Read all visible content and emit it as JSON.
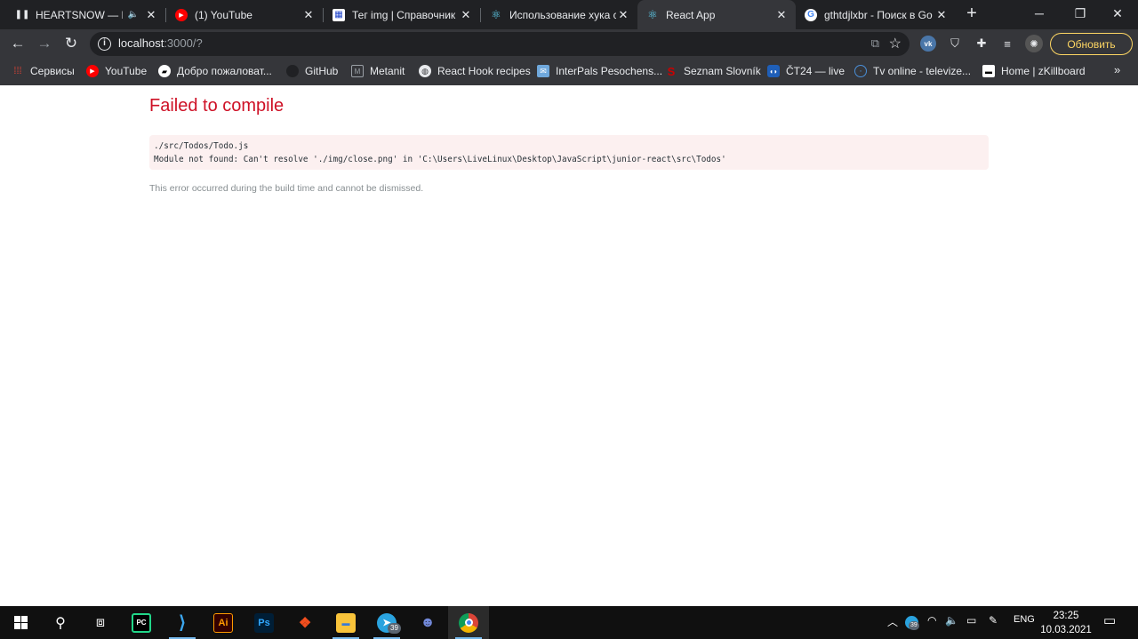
{
  "browser": {
    "tabs": [
      {
        "title": "HEARTSNOW — Pr",
        "icon": "pause-icon",
        "audio": true,
        "active": false
      },
      {
        "title": "(1) YouTube",
        "icon": "youtube-icon",
        "active": false
      },
      {
        "title": "Тег img | Справочник",
        "icon": "htmlbook-icon",
        "active": false
      },
      {
        "title": "Использование хука с",
        "icon": "react-icon",
        "active": false
      },
      {
        "title": "React App",
        "icon": "react-icon",
        "active": true
      },
      {
        "title": "gthtdjlxbr - Поиск в Go",
        "icon": "google-icon",
        "active": false
      }
    ],
    "url": {
      "host": "localhost",
      "path": ":3000/?"
    },
    "update_label": "Обновить",
    "bookmarks": [
      {
        "label": "Сервисы",
        "icon": "apps-grid-icon"
      },
      {
        "label": "YouTube",
        "icon": "youtube-icon"
      },
      {
        "label": "Добро пожаловат...",
        "icon": "chat-icon"
      },
      {
        "label": "GitHub",
        "icon": "github-icon"
      },
      {
        "label": "Metanit",
        "icon": "metanit-icon"
      },
      {
        "label": "React Hook recipes",
        "icon": "globe-icon"
      },
      {
        "label": "InterPals Pesochens...",
        "icon": "mail-icon"
      },
      {
        "label": "Seznam Slovník",
        "icon": "seznam-icon"
      },
      {
        "label": "ČT24 — live",
        "icon": "ct24-icon"
      },
      {
        "label": "Tv online - televize...",
        "icon": "tv-icon"
      },
      {
        "label": "Home | zKillboard",
        "icon": "zkillboard-icon"
      }
    ]
  },
  "page": {
    "title": "Failed to compile",
    "error_line1": "./src/Todos/Todo.js",
    "error_line2": "Module not found: Can't resolve './img/close.png' in 'C:\\Users\\LiveLinux\\Desktop\\JavaScript\\junior-react\\src\\Todos'",
    "note": "This error occurred during the build time and cannot be dismissed."
  },
  "taskbar": {
    "apps": [
      "windows-start-icon",
      "search-icon",
      "task-view-icon",
      "pycharm-icon",
      "vscode-icon",
      "illustrator-icon",
      "photoshop-icon",
      "figma-icon",
      "file-explorer-icon",
      "telegram-icon",
      "discord-icon",
      "chrome-icon"
    ],
    "telegram_badge": "39",
    "tray_badge": "39",
    "language": "ENG",
    "time": "23:25",
    "date": "10.03.2021"
  }
}
